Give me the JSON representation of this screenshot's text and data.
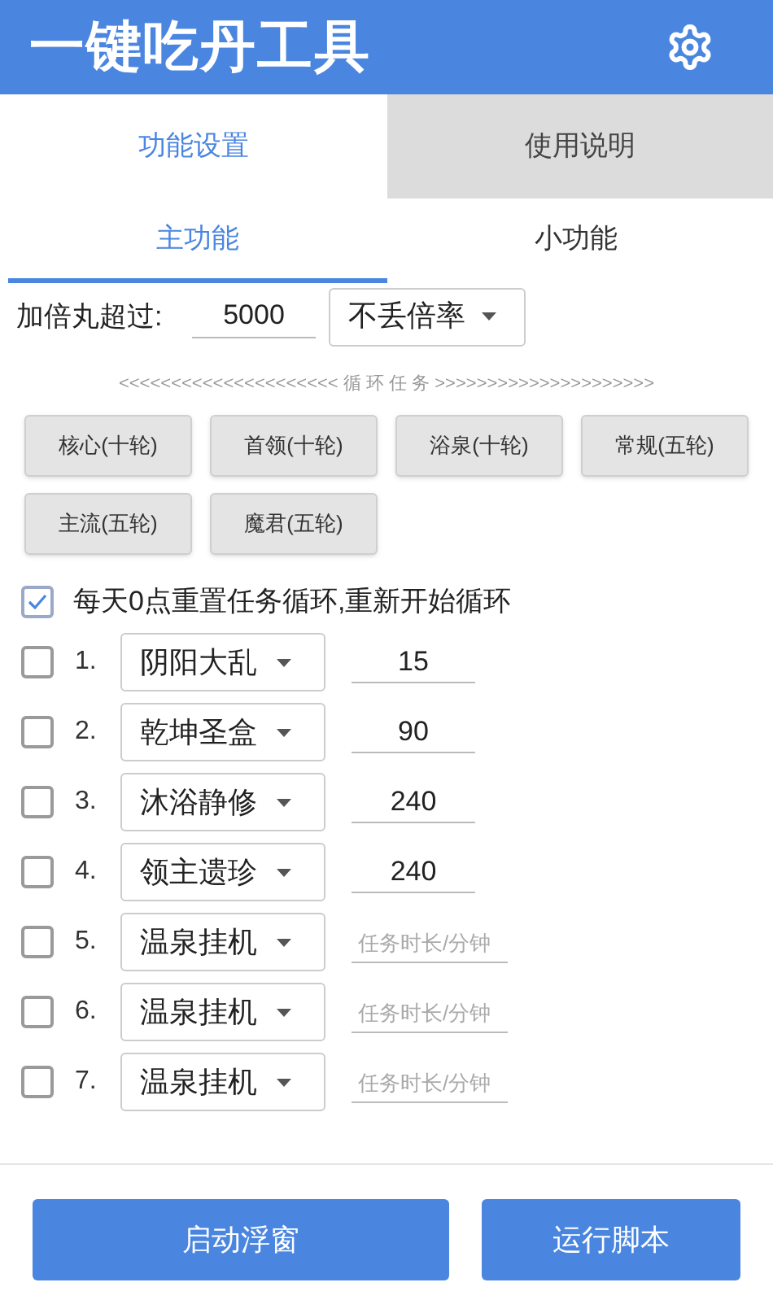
{
  "app_bar": {
    "title": "一键吃丹工具"
  },
  "tabs": [
    {
      "label": "功能设置",
      "selected": true
    },
    {
      "label": "使用说明",
      "selected": false
    }
  ],
  "sub_tabs": [
    {
      "label": "主功能",
      "selected": true
    },
    {
      "label": "小功能",
      "selected": false
    }
  ],
  "pill_setting": {
    "label": "加倍丸超过:",
    "value": "5000",
    "dropdown": "不丢倍率"
  },
  "section_divider": "<<<<<<<<<<<<<<<<<<<<< 循 环 任 务 >>>>>>>>>>>>>>>>>>>>>",
  "preset_buttons": [
    "核心(十轮)",
    "首领(十轮)",
    "浴泉(十轮)",
    "常规(五轮)",
    "主流(五轮)",
    "魔君(五轮)"
  ],
  "daily_reset": {
    "label": "每天0点重置任务循环,重新开始循环",
    "checked": true
  },
  "tasks": [
    {
      "number": "1.",
      "checked": false,
      "task": "阴阳大乱",
      "duration": "15"
    },
    {
      "number": "2.",
      "checked": false,
      "task": "乾坤圣盒",
      "duration": "90"
    },
    {
      "number": "3.",
      "checked": false,
      "task": "沐浴静修",
      "duration": "240"
    },
    {
      "number": "4.",
      "checked": false,
      "task": "领主遗珍",
      "duration": "240"
    },
    {
      "number": "5.",
      "checked": false,
      "task": "温泉挂机",
      "placeholder": "任务时长/分钟"
    },
    {
      "number": "6.",
      "checked": false,
      "task": "温泉挂机",
      "placeholder": "任务时长/分钟"
    },
    {
      "number": "7.",
      "checked": false,
      "task": "温泉挂机",
      "placeholder": "任务时长/分钟"
    }
  ],
  "bottom_buttons": [
    "启动浮窗",
    "运行脚本"
  ]
}
